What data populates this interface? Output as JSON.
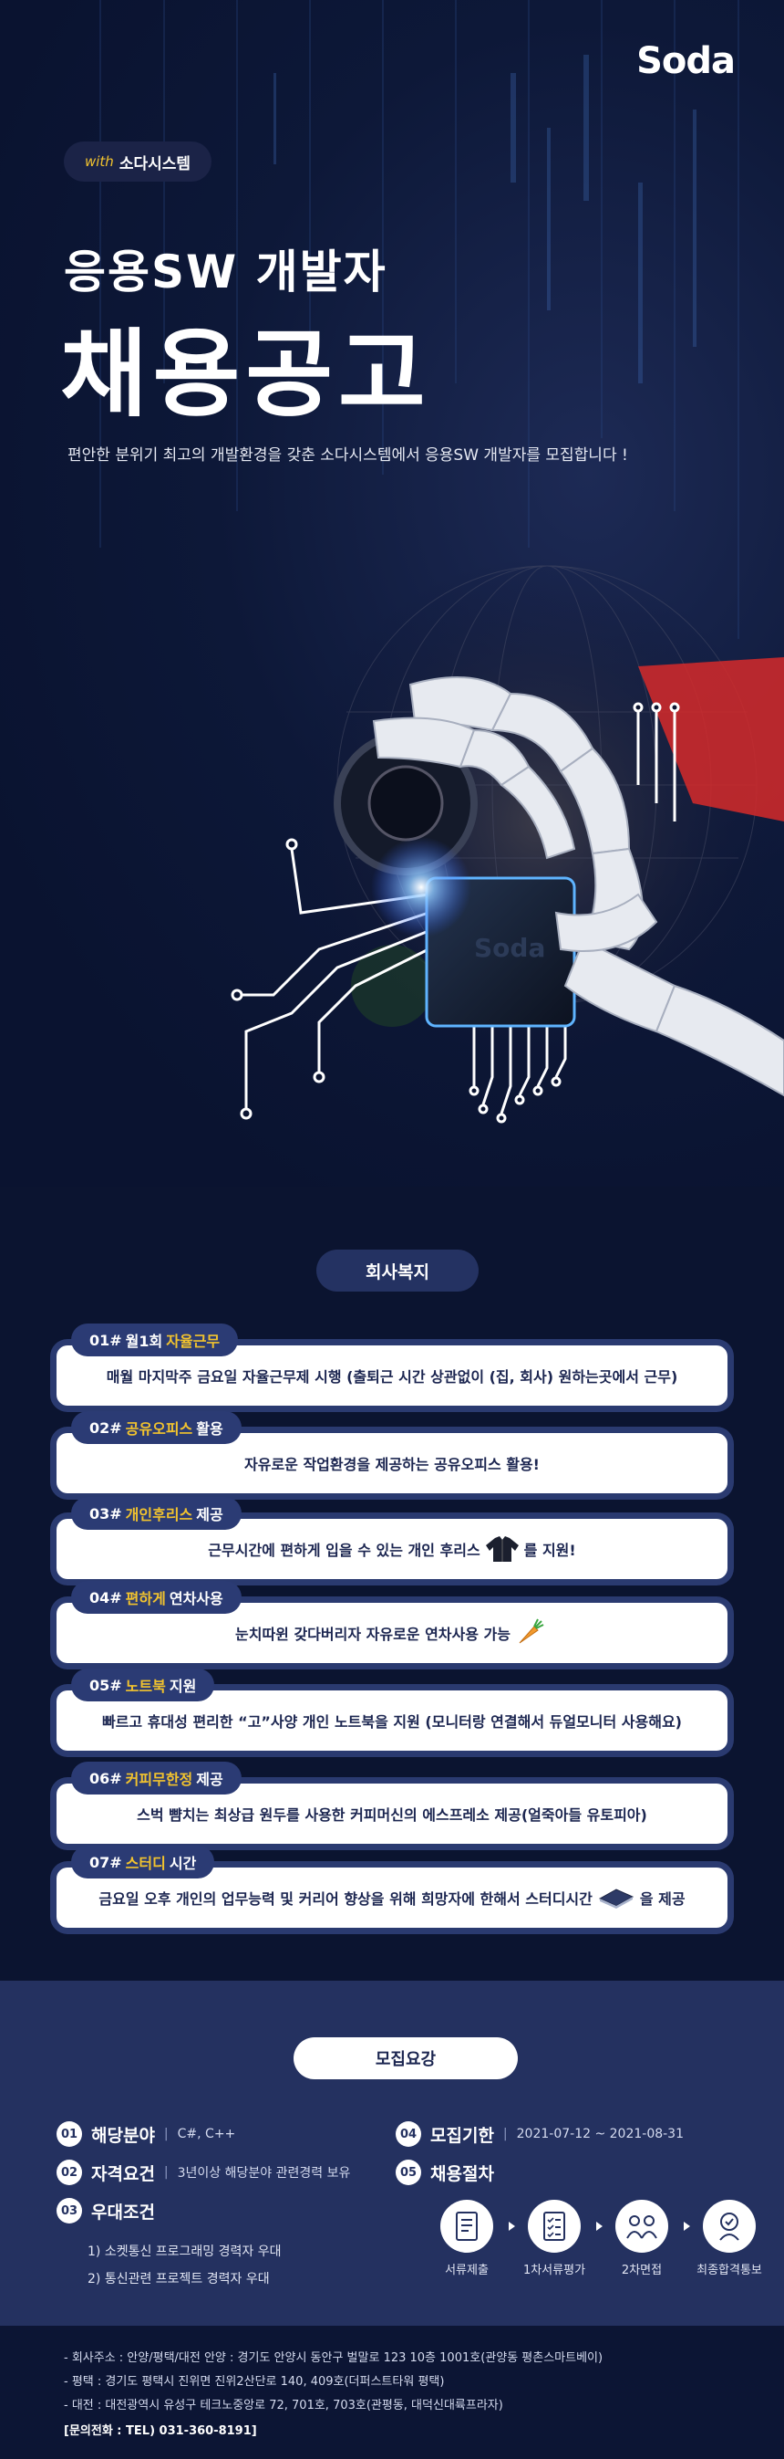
{
  "hero": {
    "logo": "Soda",
    "with_label": "with",
    "company": "소다시스템",
    "subtitle": "응용SW 개발자",
    "title": "채용공고",
    "description": "편안한 분위기 최고의 개발환경을 갖춘 소다시스템에서 응용SW 개발자를 모집합니다 !",
    "chip_logo": "Soda"
  },
  "welfare": {
    "title": "회사복지",
    "items": [
      {
        "num": "01#",
        "pre": "월1회",
        "highlight": "자율근무",
        "post": "",
        "text": "매월 마지막주 금요일 자율근무제 시행 (출퇴근 시간 상관없이 (집, 회사) 원하는곳에서 근무)"
      },
      {
        "num": "02#",
        "pre": "",
        "highlight": "공유오피스",
        "post": "활용",
        "text": "자유로운 작업환경을 제공하는 공유오피스 활용!"
      },
      {
        "num": "03#",
        "pre": "",
        "highlight": "개인후리스",
        "post": "제공",
        "text": "근무시간에 편하게 입을 수 있는 개인 후리스",
        "text_after": "를 지원!"
      },
      {
        "num": "04#",
        "pre": "",
        "highlight": "편하게",
        "post": "연차사용",
        "text": "눈치따윈 갖다버리자 자유로운 연차사용 가능"
      },
      {
        "num": "05#",
        "pre": "",
        "highlight": "노트북",
        "post": "지원",
        "text": "빠르고 휴대성 편리한 “고”사양 개인 노트북을 지원 (모니터랑 연결해서 듀얼모니터 사용해요)"
      },
      {
        "num": "06#",
        "pre": "",
        "highlight": "커피무한정",
        "post": "제공",
        "text": "스벅 뺨치는 최상급 원두를 사용한 커피머신의 에스프레소 제공(얼죽아들 유토피아)"
      },
      {
        "num": "07#",
        "pre": "",
        "highlight": "스터디",
        "post": "시간",
        "text": "금요일 오후 개인의 업무능력 및 커리어 향상을 위해 희망자에 한해서 스터디시간",
        "text_after": "을 제공"
      }
    ]
  },
  "recruit": {
    "title": "모집요강",
    "field": {
      "num": "01",
      "label": "해당분야",
      "value": "C#, C++"
    },
    "qualification": {
      "num": "02",
      "label": "자격요건",
      "value": "3년이상 해당분야 관련경력 보유"
    },
    "preference": {
      "num": "03",
      "label": "우대조건",
      "items": [
        "1) 소켓통신 프로그래밍 경력자 우대",
        "2) 통신관련 프로젝트 경력자 우대"
      ]
    },
    "deadline": {
      "num": "04",
      "label": "모집기한",
      "value": "2021-07-12 ~ 2021-08-31"
    },
    "process": {
      "num": "05",
      "label": "채용절차",
      "steps": [
        "서류제출",
        "1차서류평가",
        "2차면접",
        "최종합격통보"
      ]
    }
  },
  "footer": {
    "address_label": "회사주소 :",
    "address": "- 회사주소 : 안양/평택/대전 안양 : 경기도 안양시 동안구 벌말로 123 10층 1001호(관양동 평촌스마트베이)",
    "pyeongtaek": "- 평택 : 경기도 평택시 진위면 진위2산단로 140, 409호(더퍼스트타워 평택)",
    "daejeon": "- 대전 : 대전광역시 유성구 테크노중앙로 72, 701호, 703호(관평동, 대덕신대륙프라자)",
    "phone": "[문의전화 : TEL) 031-360-8191]"
  },
  "colors": {
    "accent": "#f2c32e",
    "navy": "#243160",
    "card_border": "#2a3a70",
    "red_glow": "#d62a2a"
  }
}
